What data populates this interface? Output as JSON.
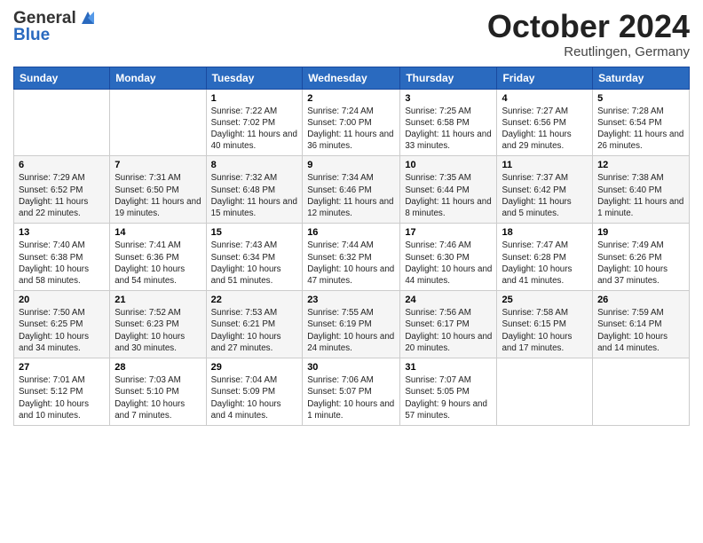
{
  "logo": {
    "general": "General",
    "blue": "Blue"
  },
  "title": "October 2024",
  "subtitle": "Reutlingen, Germany",
  "days_header": [
    "Sunday",
    "Monday",
    "Tuesday",
    "Wednesday",
    "Thursday",
    "Friday",
    "Saturday"
  ],
  "weeks": [
    [
      {
        "day": "",
        "info": ""
      },
      {
        "day": "",
        "info": ""
      },
      {
        "day": "1",
        "info": "Sunrise: 7:22 AM\nSunset: 7:02 PM\nDaylight: 11 hours and 40 minutes."
      },
      {
        "day": "2",
        "info": "Sunrise: 7:24 AM\nSunset: 7:00 PM\nDaylight: 11 hours and 36 minutes."
      },
      {
        "day": "3",
        "info": "Sunrise: 7:25 AM\nSunset: 6:58 PM\nDaylight: 11 hours and 33 minutes."
      },
      {
        "day": "4",
        "info": "Sunrise: 7:27 AM\nSunset: 6:56 PM\nDaylight: 11 hours and 29 minutes."
      },
      {
        "day": "5",
        "info": "Sunrise: 7:28 AM\nSunset: 6:54 PM\nDaylight: 11 hours and 26 minutes."
      }
    ],
    [
      {
        "day": "6",
        "info": "Sunrise: 7:29 AM\nSunset: 6:52 PM\nDaylight: 11 hours and 22 minutes."
      },
      {
        "day": "7",
        "info": "Sunrise: 7:31 AM\nSunset: 6:50 PM\nDaylight: 11 hours and 19 minutes."
      },
      {
        "day": "8",
        "info": "Sunrise: 7:32 AM\nSunset: 6:48 PM\nDaylight: 11 hours and 15 minutes."
      },
      {
        "day": "9",
        "info": "Sunrise: 7:34 AM\nSunset: 6:46 PM\nDaylight: 11 hours and 12 minutes."
      },
      {
        "day": "10",
        "info": "Sunrise: 7:35 AM\nSunset: 6:44 PM\nDaylight: 11 hours and 8 minutes."
      },
      {
        "day": "11",
        "info": "Sunrise: 7:37 AM\nSunset: 6:42 PM\nDaylight: 11 hours and 5 minutes."
      },
      {
        "day": "12",
        "info": "Sunrise: 7:38 AM\nSunset: 6:40 PM\nDaylight: 11 hours and 1 minute."
      }
    ],
    [
      {
        "day": "13",
        "info": "Sunrise: 7:40 AM\nSunset: 6:38 PM\nDaylight: 10 hours and 58 minutes."
      },
      {
        "day": "14",
        "info": "Sunrise: 7:41 AM\nSunset: 6:36 PM\nDaylight: 10 hours and 54 minutes."
      },
      {
        "day": "15",
        "info": "Sunrise: 7:43 AM\nSunset: 6:34 PM\nDaylight: 10 hours and 51 minutes."
      },
      {
        "day": "16",
        "info": "Sunrise: 7:44 AM\nSunset: 6:32 PM\nDaylight: 10 hours and 47 minutes."
      },
      {
        "day": "17",
        "info": "Sunrise: 7:46 AM\nSunset: 6:30 PM\nDaylight: 10 hours and 44 minutes."
      },
      {
        "day": "18",
        "info": "Sunrise: 7:47 AM\nSunset: 6:28 PM\nDaylight: 10 hours and 41 minutes."
      },
      {
        "day": "19",
        "info": "Sunrise: 7:49 AM\nSunset: 6:26 PM\nDaylight: 10 hours and 37 minutes."
      }
    ],
    [
      {
        "day": "20",
        "info": "Sunrise: 7:50 AM\nSunset: 6:25 PM\nDaylight: 10 hours and 34 minutes."
      },
      {
        "day": "21",
        "info": "Sunrise: 7:52 AM\nSunset: 6:23 PM\nDaylight: 10 hours and 30 minutes."
      },
      {
        "day": "22",
        "info": "Sunrise: 7:53 AM\nSunset: 6:21 PM\nDaylight: 10 hours and 27 minutes."
      },
      {
        "day": "23",
        "info": "Sunrise: 7:55 AM\nSunset: 6:19 PM\nDaylight: 10 hours and 24 minutes."
      },
      {
        "day": "24",
        "info": "Sunrise: 7:56 AM\nSunset: 6:17 PM\nDaylight: 10 hours and 20 minutes."
      },
      {
        "day": "25",
        "info": "Sunrise: 7:58 AM\nSunset: 6:15 PM\nDaylight: 10 hours and 17 minutes."
      },
      {
        "day": "26",
        "info": "Sunrise: 7:59 AM\nSunset: 6:14 PM\nDaylight: 10 hours and 14 minutes."
      }
    ],
    [
      {
        "day": "27",
        "info": "Sunrise: 7:01 AM\nSunset: 5:12 PM\nDaylight: 10 hours and 10 minutes."
      },
      {
        "day": "28",
        "info": "Sunrise: 7:03 AM\nSunset: 5:10 PM\nDaylight: 10 hours and 7 minutes."
      },
      {
        "day": "29",
        "info": "Sunrise: 7:04 AM\nSunset: 5:09 PM\nDaylight: 10 hours and 4 minutes."
      },
      {
        "day": "30",
        "info": "Sunrise: 7:06 AM\nSunset: 5:07 PM\nDaylight: 10 hours and 1 minute."
      },
      {
        "day": "31",
        "info": "Sunrise: 7:07 AM\nSunset: 5:05 PM\nDaylight: 9 hours and 57 minutes."
      },
      {
        "day": "",
        "info": ""
      },
      {
        "day": "",
        "info": ""
      }
    ]
  ]
}
